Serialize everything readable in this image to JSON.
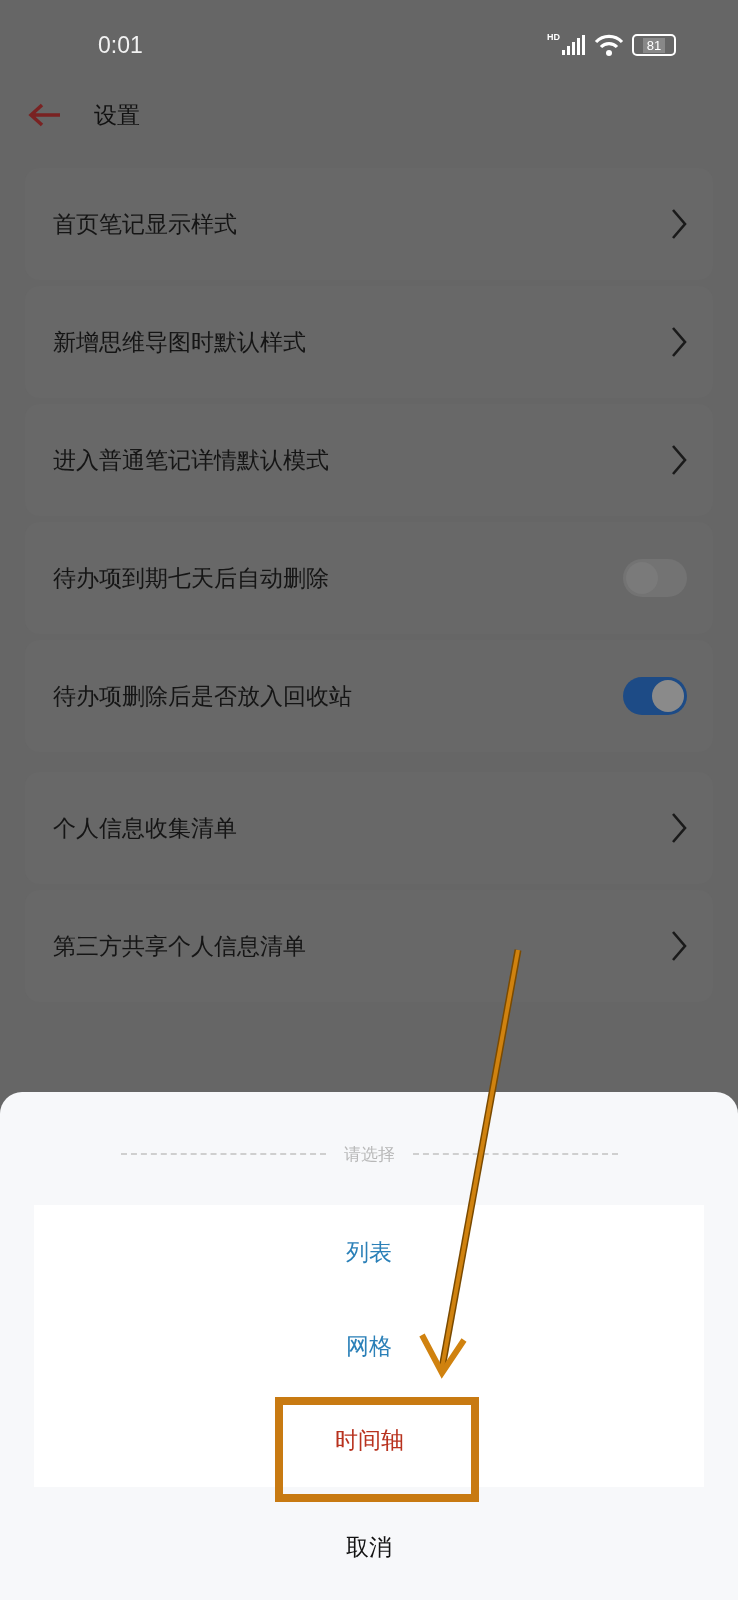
{
  "status_bar": {
    "time": "0:01",
    "network": "HD",
    "battery": "81"
  },
  "header": {
    "title": "设置"
  },
  "groups": [
    {
      "items": [
        {
          "kind": "link",
          "label": "首页笔记显示样式"
        },
        {
          "kind": "link",
          "label": "新增思维导图时默认样式"
        },
        {
          "kind": "link",
          "label": "进入普通笔记详情默认模式"
        },
        {
          "kind": "toggle",
          "label": "待办项到期七天后自动删除",
          "on": false
        },
        {
          "kind": "toggle",
          "label": "待办项删除后是否放入回收站",
          "on": true
        }
      ]
    },
    {
      "items": [
        {
          "kind": "link",
          "label": "个人信息收集清单"
        },
        {
          "kind": "link",
          "label": "第三方共享个人信息清单"
        }
      ]
    }
  ],
  "sheet": {
    "title": "请选择",
    "options": [
      {
        "label": "列表",
        "selected": false
      },
      {
        "label": "网格",
        "selected": false
      },
      {
        "label": "时间轴",
        "selected": true
      }
    ],
    "cancel": "取消"
  }
}
